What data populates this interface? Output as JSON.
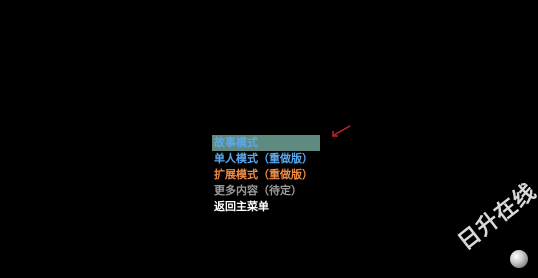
{
  "menu": {
    "items": [
      {
        "label": "故事模式",
        "color": "#5ea8e8",
        "selected": true
      },
      {
        "label": "单人模式（重做版）",
        "color": "#58a9f0",
        "selected": false
      },
      {
        "label": "扩展模式（重做版）",
        "color": "#ee8a45",
        "selected": false
      },
      {
        "label": "更多内容（待定）",
        "color": "#9a9a9a",
        "selected": false
      },
      {
        "label": "返回主菜单",
        "color": "#ffffff",
        "selected": false
      }
    ],
    "selection_highlight": "#5e8a7f"
  },
  "annotation": {
    "arrow_color": "#cc2222",
    "arrow_icon": "red-arrow-icon"
  },
  "watermark": {
    "text": "日升在线",
    "icon": "sphere-logo-icon"
  }
}
